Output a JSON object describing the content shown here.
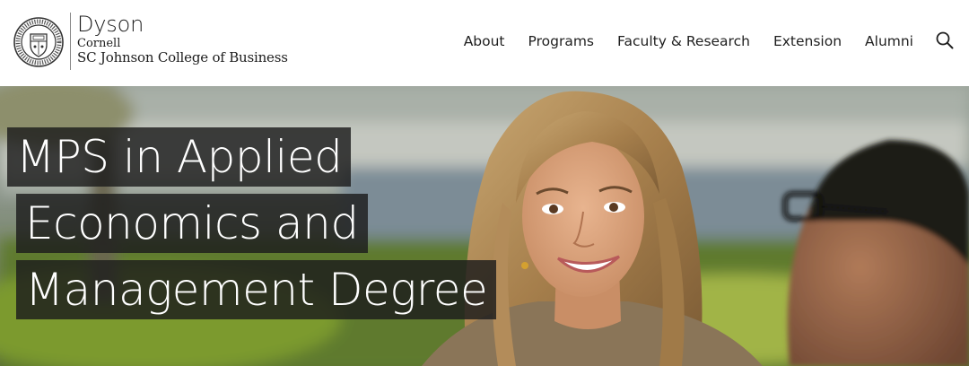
{
  "brand": {
    "name": "Dyson",
    "university": "Cornell",
    "college": "SC Johnson College of Business",
    "seal_text": "CORNELL UNIVERSITY · FOUNDED A.D. 1865"
  },
  "nav": {
    "items": [
      {
        "label": "About"
      },
      {
        "label": "Programs"
      },
      {
        "label": "Faculty & Research"
      },
      {
        "label": "Extension"
      },
      {
        "label": "Alumni"
      }
    ],
    "search_icon": "search-icon"
  },
  "hero": {
    "headline_lines": [
      "MPS in Applied",
      "Economics and",
      "Management Degree"
    ]
  },
  "colors": {
    "header_bg": "#ffffff",
    "nav_text": "#1f1f1f",
    "headline_bg": "#1c1c1c",
    "headline_text": "#ffffff"
  }
}
